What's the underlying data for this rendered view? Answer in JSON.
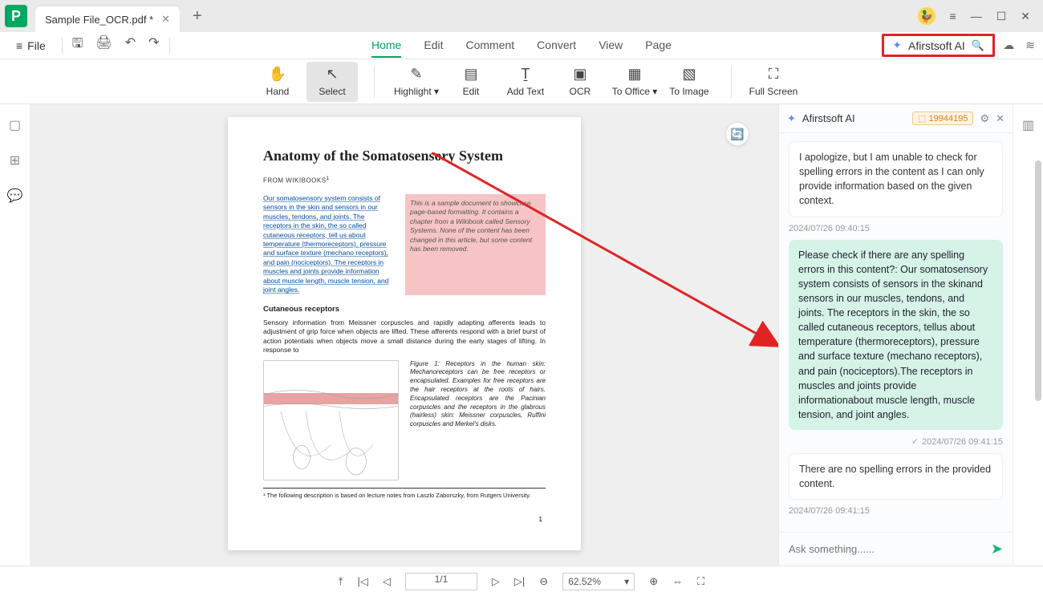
{
  "tab": {
    "title": "Sample File_OCR.pdf *"
  },
  "menubar": {
    "file": "File",
    "tabs": [
      "Home",
      "Edit",
      "Comment",
      "Convert",
      "View",
      "Page"
    ],
    "active": "Home",
    "ai_label": "Afirstsoft AI"
  },
  "toolbar": {
    "hand": "Hand",
    "select": "Select",
    "highlight": "Highlight",
    "edit": "Edit",
    "addtext": "Add Text",
    "ocr": "OCR",
    "tooffice": "To Office",
    "toimage": "To Image",
    "fullscreen": "Full Screen"
  },
  "document": {
    "title": "Anatomy of the Somatosensory System",
    "from": "FROM WIKIBOOKS",
    "highlighted": "Our somatosensory system consists of sensors in the skin and sensors in our muscles, tendons, and joints. The receptors in the skin, the so called cutaneous receptors, tell us about temperature (thermoreceptors), pressure and surface texture (mechano receptors), and pain (nociceptors). The receptors in muscles and joints provide information about muscle length, muscle tension, and joint angles.",
    "sample_note": "This is a sample document to showcase page-based formatting. It contains a chapter from a Wikibook called Sensory Systems. None of the content has been changed in this article, but some content has been removed.",
    "sub1": "Cutaneous receptors",
    "body1": "Sensory information from Meissner corpuscles and rapidly adapting afferents leads to adjustment of grip force when objects are lifted. These afferents respond with a brief burst of action potentials when objects move a small distance during the early stages of lifting. In response to",
    "fig_caption": "Figure 1: Receptors in the human skin: Mechanoreceptors can be free receptors or encapsulated. Examples for free receptors are the hair receptors at the roots of hairs. Encapsulated receptors are the Pacinian corpuscles and the receptors in the glabrous (hairless) skin: Meissner corpuscles, Ruffini corpuscles and Merkel's disks.",
    "footnote": "¹ The following description is based on lecture notes from Laszlo Zaborszky, from Rutgers University.",
    "page_num": "1"
  },
  "ai": {
    "title": "Afirstsoft AI",
    "badge": "19944195",
    "msg1": "I apologize, but I am unable to check for spelling errors in the content as I can only provide information based on the given context.",
    "ts1": "2024/07/26 09:40:15",
    "msg2": "Please check if there are any spelling errors in this content?: Our somatosensory system consists of sensors in the skinand sensors in our muscles, tendons, and joints. The receptors in the skin, the so called cutaneous receptors, tellus about temperature (thermoreceptors), pressure and surface texture (mechano receptors), and pain (nociceptors).The receptors in muscles and joints provide informationabout muscle length, muscle tension, and joint angles.",
    "ts2": "2024/07/26 09:41:15",
    "msg3": "There are no spelling errors in the provided content.",
    "ts3": "2024/07/26 09:41:15",
    "placeholder": "Ask something......"
  },
  "statusbar": {
    "page": "1/1",
    "zoom": "62.52%"
  }
}
